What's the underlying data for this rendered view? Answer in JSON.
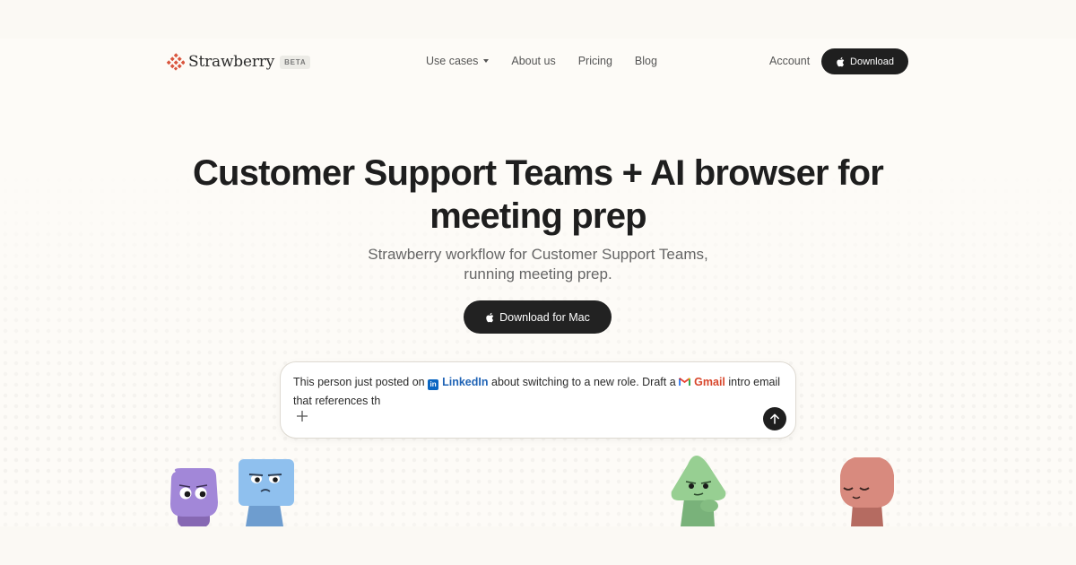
{
  "nav": {
    "brand": "Strawberry",
    "badge": "BETA",
    "menu": [
      "Use cases",
      "About us",
      "Pricing",
      "Blog"
    ],
    "account": "Account",
    "download": "Download"
  },
  "hero": {
    "title_line1": "Customer Support Teams + AI browser for",
    "title_line2": "meeting prep",
    "subtitle_line1": "Strawberry workflow for Customer Support Teams,",
    "subtitle_line2": "running meeting prep.",
    "cta": "Download for Mac"
  },
  "prompt": {
    "part1": "This person just posted on",
    "linkedin": "LinkedIn",
    "part2": "about switching to a new role. Draft a",
    "gmail": "Gmail",
    "part3": "intro email that references th"
  },
  "colors": {
    "brand": "#d9553d",
    "linkedin": "#1f63b5",
    "gmail": "#d8472c",
    "button_dark": "#1f1f1f"
  },
  "icons": [
    "strawberry-logo-icon",
    "chevron-down-icon",
    "apple-icon",
    "linkedin-icon",
    "gmail-icon",
    "plus-icon",
    "arrow-up-icon"
  ]
}
